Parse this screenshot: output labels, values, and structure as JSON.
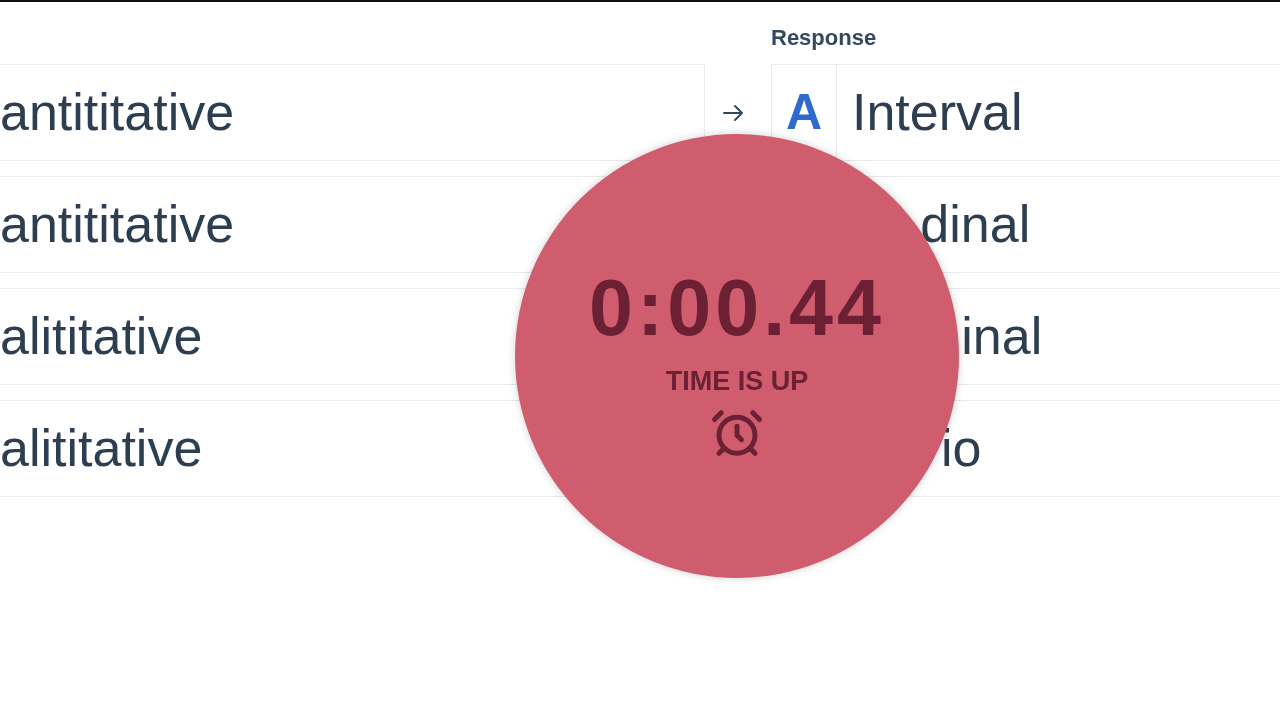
{
  "header": {
    "response_label": "Response"
  },
  "rows": [
    {
      "term": "antititative",
      "connector": true,
      "letter": "A",
      "response": "Interval"
    },
    {
      "term": "antititative",
      "connector": false,
      "response": "dinal"
    },
    {
      "term": "alititative",
      "connector": false,
      "response": "inal"
    },
    {
      "term": "alititative",
      "connector": false,
      "response": "io"
    }
  ],
  "timer": {
    "time": "0:00.44",
    "status": "TIME IS UP"
  }
}
